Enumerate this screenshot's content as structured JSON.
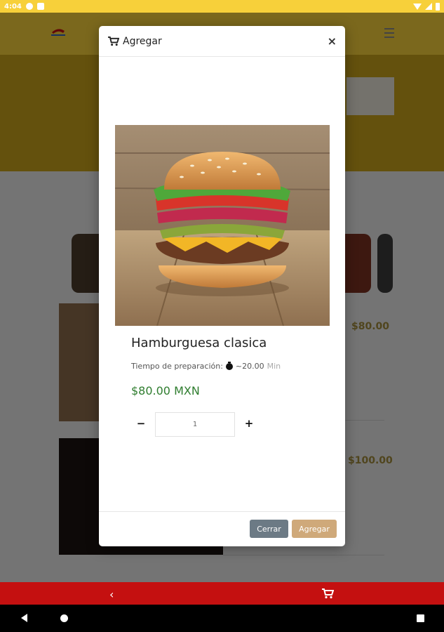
{
  "status_bar": {
    "time": "4:04"
  },
  "background": {
    "product_prices": [
      "$80.00",
      "$100.00"
    ]
  },
  "modal": {
    "title": "Agregar",
    "close_symbol": "×",
    "product_name": "Hamburguesa clasica",
    "prep_label": "Tiempo de preparación:",
    "prep_value": "~20.00",
    "prep_unit": "Min",
    "price": "$80.00 MXN",
    "quantity": "1",
    "qty_minus": "−",
    "qty_plus": "+",
    "buttons": {
      "close": "Cerrar",
      "add": "Agregar"
    }
  },
  "bottom_nav": {
    "back_symbol": "‹"
  },
  "colors": {
    "status_bar": "#f7d03a",
    "bottom_nav": "#c41010",
    "price_green": "#2f7d2f",
    "btn_close": "#6c7a85",
    "btn_add": "#cfa97a"
  },
  "icons": [
    "cart-icon",
    "stopwatch-icon",
    "close-icon",
    "back-icon",
    "menu-icon"
  ]
}
